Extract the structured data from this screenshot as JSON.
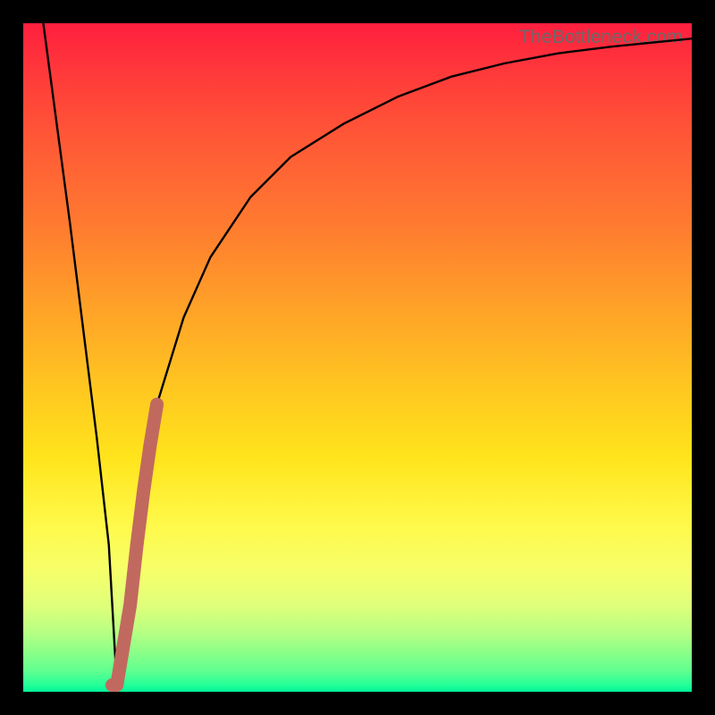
{
  "watermark": "TheBottleneck.com",
  "colors": {
    "frame": "#000000",
    "curve": "#000000",
    "marker": "#c1695f",
    "gradient_stops": [
      "#ff1f3e",
      "#ff3b3a",
      "#ff5a36",
      "#ff7a30",
      "#ffa028",
      "#ffc820",
      "#ffe41c",
      "#fff94a",
      "#f6ff6a",
      "#e0ff7a",
      "#b8ff82",
      "#8dff88",
      "#5eff90",
      "#23ff98",
      "#00f79a"
    ]
  },
  "chart_data": {
    "type": "line",
    "title": "",
    "xlabel": "",
    "ylabel": "",
    "xlim": [
      0,
      100
    ],
    "ylim": [
      0,
      100
    ],
    "series": [
      {
        "name": "bottleneck-curve",
        "x": [
          3,
          5,
          7,
          9,
          11,
          12.8,
          14,
          16,
          18,
          20,
          24,
          28,
          34,
          40,
          48,
          56,
          64,
          72,
          80,
          88,
          96,
          100
        ],
        "y": [
          100,
          85,
          70,
          54,
          38,
          22,
          1,
          13,
          30,
          43,
          56,
          65,
          74,
          80,
          85,
          89,
          92,
          94,
          95.5,
          96.5,
          97.3,
          97.7
        ]
      }
    ],
    "marker_segment": {
      "name": "highlighted-segment",
      "x": [
        13.3,
        14.0,
        15.0,
        16.0,
        17.0,
        18.0,
        19.0,
        20.0
      ],
      "y": [
        1.0,
        1.0,
        7.0,
        13.0,
        22.0,
        30.0,
        37.0,
        43.0
      ]
    }
  }
}
